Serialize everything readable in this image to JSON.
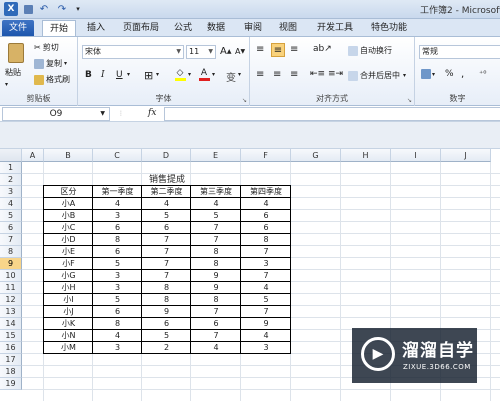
{
  "window": {
    "title": "工作簿2 - Microsoft"
  },
  "quick_access": [
    "save-icon",
    "undo-icon",
    "redo-icon",
    "customize-icon"
  ],
  "tabs": {
    "file": "文件",
    "items": [
      "开始",
      "插入",
      "页面布局",
      "公式",
      "数据",
      "审阅",
      "视图",
      "开发工具",
      "特色功能"
    ]
  },
  "ribbon": {
    "clipboard": {
      "paste": "粘贴",
      "cut": "剪切",
      "copy": "复制",
      "format_painter": "格式刷",
      "group": "剪贴板"
    },
    "font": {
      "name": "宋体",
      "size": "11",
      "grow": "A",
      "shrink": "A",
      "bold": "B",
      "italic": "I",
      "underline": "U",
      "group": "字体"
    },
    "align": {
      "wrap": "自动换行",
      "merge": "合并后居中",
      "group": "对齐方式"
    },
    "number": {
      "format": "常规",
      "percent": "%",
      "comma": ",",
      "group": "数字"
    }
  },
  "formula_bar": {
    "name_box": "O9",
    "fx": "fx",
    "formula": ""
  },
  "columns": [
    "A",
    "B",
    "C",
    "D",
    "E",
    "F",
    "G",
    "H",
    "I",
    "J"
  ],
  "rows": [
    "1",
    "2",
    "3",
    "4",
    "5",
    "6",
    "7",
    "8",
    "9",
    "10",
    "11",
    "12",
    "13",
    "14",
    "15",
    "16",
    "17",
    "18",
    "19"
  ],
  "selected_row": "9",
  "table": {
    "title": "销售提成",
    "headers": [
      "区分",
      "第一季度",
      "第二季度",
      "第三季度",
      "第四季度"
    ],
    "rows": [
      [
        "小A",
        "4",
        "4",
        "4",
        "4"
      ],
      [
        "小B",
        "3",
        "5",
        "5",
        "6"
      ],
      [
        "小C",
        "6",
        "6",
        "7",
        "6"
      ],
      [
        "小D",
        "8",
        "7",
        "7",
        "8"
      ],
      [
        "小E",
        "6",
        "7",
        "8",
        "7"
      ],
      [
        "小F",
        "5",
        "7",
        "8",
        "3"
      ],
      [
        "小G",
        "3",
        "7",
        "9",
        "7"
      ],
      [
        "小H",
        "3",
        "8",
        "9",
        "4"
      ],
      [
        "小I",
        "5",
        "8",
        "8",
        "5"
      ],
      [
        "小J",
        "6",
        "9",
        "7",
        "7"
      ],
      [
        "小K",
        "8",
        "6",
        "6",
        "9"
      ],
      [
        "小N",
        "4",
        "5",
        "7",
        "4"
      ],
      [
        "小M",
        "3",
        "2",
        "4",
        "3"
      ]
    ]
  },
  "watermark": {
    "name": "溜溜自学",
    "url": "ZIXUE.3D66.COM"
  }
}
